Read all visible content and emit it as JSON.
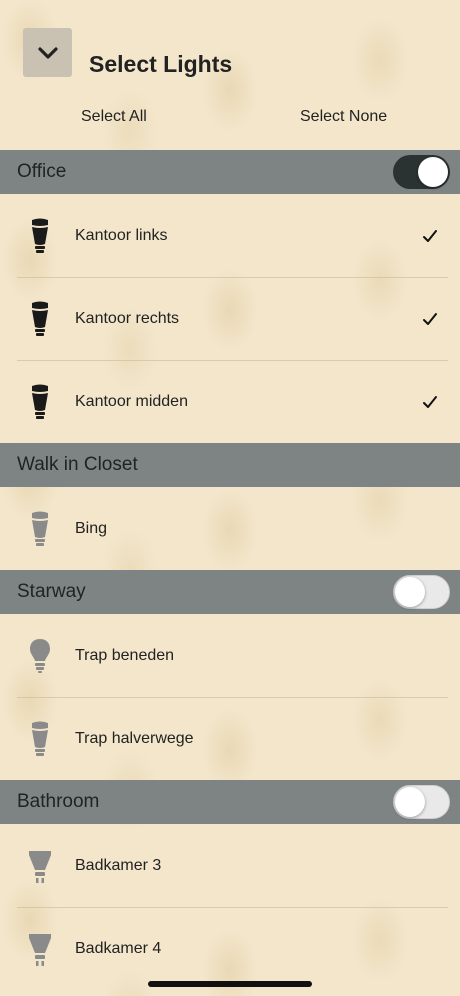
{
  "header": {
    "title": "Select Lights",
    "select_all": "Select All",
    "select_none": "Select None"
  },
  "groups": [
    {
      "name": "Office",
      "toggle": "on",
      "lights": [
        {
          "name": "Kantoor links",
          "checked": true,
          "bulb": "candle-on"
        },
        {
          "name": "Kantoor rechts",
          "checked": true,
          "bulb": "candle-on"
        },
        {
          "name": "Kantoor midden",
          "checked": true,
          "bulb": "candle-on"
        }
      ]
    },
    {
      "name": "Walk in Closet",
      "toggle": null,
      "lights": [
        {
          "name": "Bing",
          "checked": false,
          "bulb": "candle-off"
        }
      ]
    },
    {
      "name": "Starway",
      "toggle": "off",
      "lights": [
        {
          "name": "Trap beneden",
          "checked": false,
          "bulb": "bulb-off"
        },
        {
          "name": "Trap halverwege",
          "checked": false,
          "bulb": "candle-off"
        }
      ]
    },
    {
      "name": "Bathroom",
      "toggle": "off",
      "lights": [
        {
          "name": "Badkamer 3",
          "checked": false,
          "bulb": "spot-off"
        },
        {
          "name": "Badkamer 4",
          "checked": false,
          "bulb": "spot-off"
        }
      ]
    }
  ],
  "colors": {
    "group_header": "#7e8484",
    "toggle_on": "#2b3232",
    "bulb_on": "#1a1a1a",
    "bulb_off": "#8a8a8a"
  }
}
